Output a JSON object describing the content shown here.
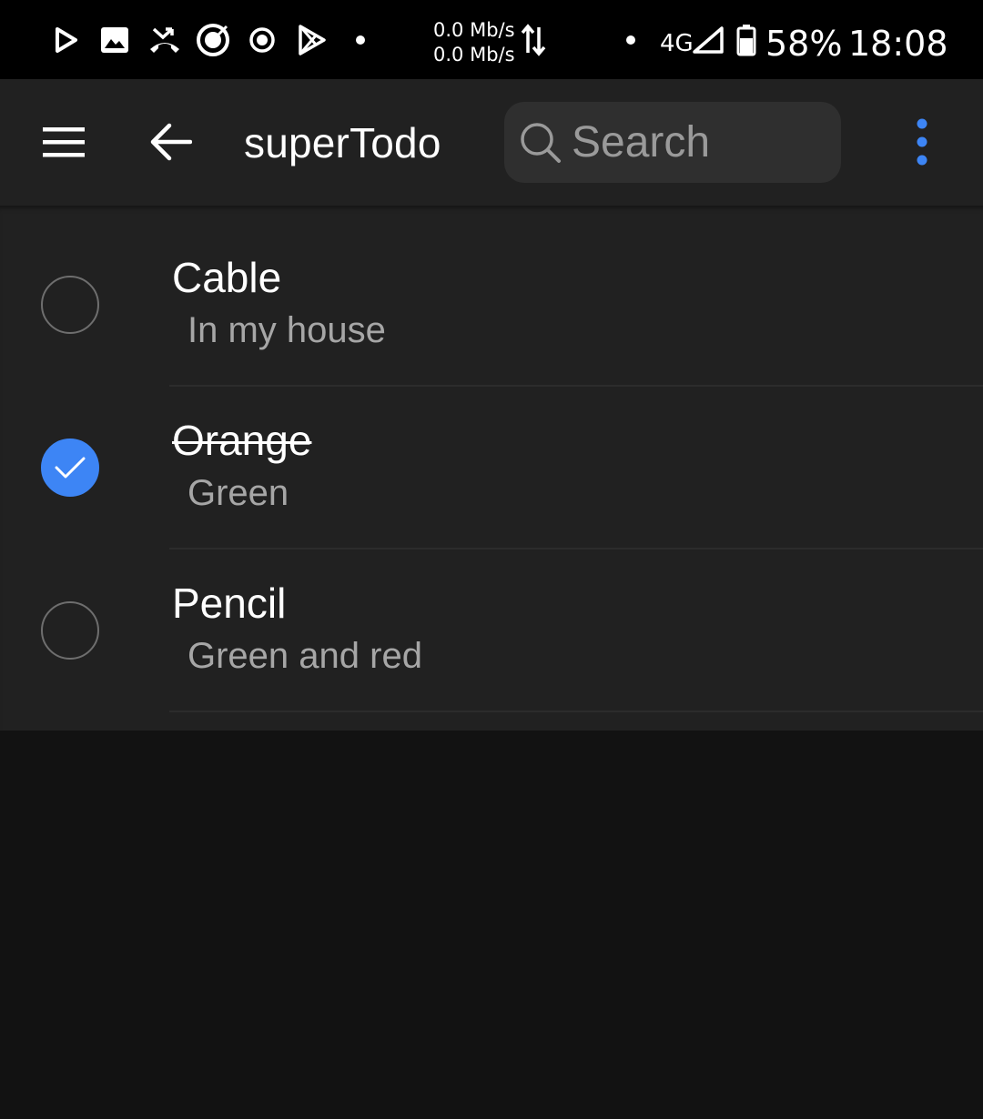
{
  "status_bar": {
    "icons": [
      "play-outline-icon",
      "image-icon",
      "missed-call-icon",
      "target-icon",
      "radio-button-icon",
      "play-store-icon",
      "dot-icon"
    ],
    "net_up": "0.0 Mb/s",
    "net_down": "0.0 Mb/s",
    "network": "4G",
    "battery": "58%",
    "time": "18:08"
  },
  "app_bar": {
    "menu_icon": "hamburger-menu-icon",
    "back_icon": "arrow-left-icon",
    "title": "superTodo",
    "search_placeholder": "Search",
    "overflow_icon": "more-vertical-icon",
    "accent_color": "#3d85f5"
  },
  "todos": [
    {
      "title": "Cable",
      "subtitle": "In my house",
      "done": false
    },
    {
      "title": "Orange",
      "subtitle": "Green",
      "done": true
    },
    {
      "title": "Pencil",
      "subtitle": "Green and red",
      "done": false
    }
  ],
  "colors": {
    "background": "#121212",
    "surface": "#212121",
    "status_bar": "#000000",
    "checked": "#3d85f5"
  }
}
